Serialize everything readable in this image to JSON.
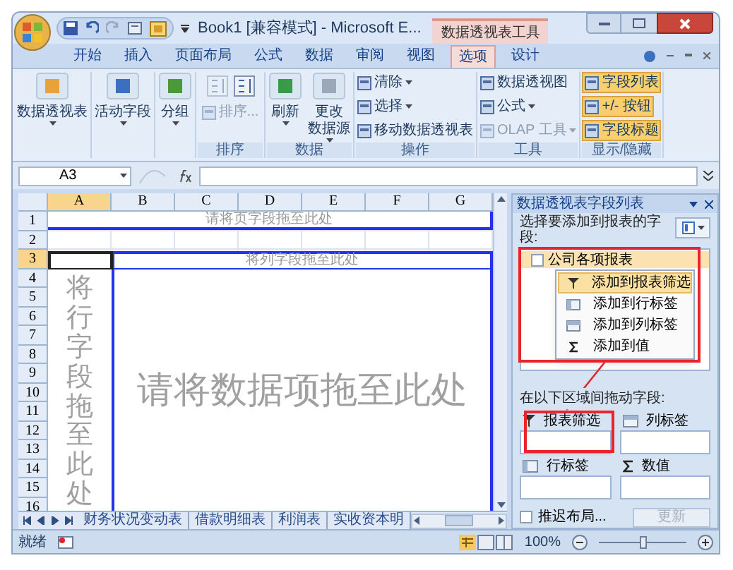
{
  "title_bar": {
    "title": "Book1  [兼容模式] - Microsoft E...",
    "context_tab": "数据透视表工具"
  },
  "ribbon_tabs": [
    {
      "label": "开始",
      "selected": false
    },
    {
      "label": "插入",
      "selected": false
    },
    {
      "label": "页面布局",
      "selected": false
    },
    {
      "label": "公式",
      "selected": false
    },
    {
      "label": "数据",
      "selected": false
    },
    {
      "label": "审阅",
      "selected": false
    },
    {
      "label": "视图",
      "selected": false
    },
    {
      "label": "选项",
      "selected": true
    },
    {
      "label": "设计",
      "selected": false
    }
  ],
  "ribbon_groups": [
    {
      "buttons": [
        {
          "kind": "large",
          "label": "数据透视表",
          "dropdown": true,
          "disabled": false
        }
      ]
    },
    {
      "buttons": [
        {
          "kind": "large",
          "label": "活动字段",
          "dropdown": true,
          "disabled": false
        }
      ]
    },
    {
      "buttons": [
        {
          "kind": "large",
          "label": "分组",
          "dropdown": true,
          "disabled": false
        }
      ]
    },
    {
      "label": "排序",
      "buttons": [
        {
          "kind": "icon",
          "disabled": true
        },
        {
          "kind": "icon",
          "disabled": false
        },
        {
          "kind": "small",
          "label": "排序...",
          "dropdown": false,
          "disabled": true
        }
      ]
    },
    {
      "label": "数据",
      "buttons": [
        {
          "kind": "large",
          "label": "刷新",
          "dropdown": true,
          "disabled": false
        },
        {
          "kind": "large",
          "label": "更改",
          "label_2": "数据源",
          "dropdown": true,
          "disabled": false
        }
      ]
    },
    {
      "label": "操作",
      "buttons": [
        {
          "kind": "small",
          "label": "清除",
          "dropdown": true,
          "disabled": false
        },
        {
          "kind": "small",
          "label": "选择",
          "dropdown": true,
          "disabled": false
        },
        {
          "kind": "small",
          "label": "移动数据透视表",
          "dropdown": false,
          "disabled": false
        }
      ]
    },
    {
      "label": "工具",
      "buttons": [
        {
          "kind": "small",
          "label": "数据透视图",
          "dropdown": false,
          "disabled": false
        },
        {
          "kind": "small",
          "label": "公式",
          "dropdown": true,
          "disabled": false
        },
        {
          "kind": "small",
          "label": "OLAP 工具",
          "dropdown": true,
          "disabled": true
        }
      ]
    },
    {
      "label": "显示/隐藏",
      "buttons": [
        {
          "kind": "small",
          "label": "字段列表",
          "dropdown": false,
          "disabled": false,
          "on": true
        },
        {
          "kind": "small",
          "label": "+/- 按钮",
          "dropdown": false,
          "disabled": false,
          "on": true
        },
        {
          "kind": "small",
          "label": "字段标题",
          "dropdown": false,
          "disabled": false,
          "on": true
        }
      ]
    }
  ],
  "formula_bar": {
    "name_box": "A3"
  },
  "sheet": {
    "columns": [
      {
        "label": "A",
        "selected": true
      },
      {
        "label": "B",
        "selected": false
      },
      {
        "label": "C",
        "selected": false
      },
      {
        "label": "D",
        "selected": false
      },
      {
        "label": "E",
        "selected": false
      },
      {
        "label": "F",
        "selected": false
      },
      {
        "label": "G",
        "selected": false
      }
    ],
    "rows": [
      {
        "label": "1",
        "selected": false
      },
      {
        "label": "2",
        "selected": false
      },
      {
        "label": "3",
        "selected": true
      },
      {
        "label": "4",
        "selected": false
      },
      {
        "label": "5",
        "selected": false
      },
      {
        "label": "6",
        "selected": false
      },
      {
        "label": "7",
        "selected": false
      },
      {
        "label": "8",
        "selected": false
      },
      {
        "label": "9",
        "selected": false
      },
      {
        "label": "10",
        "selected": false
      },
      {
        "label": "11",
        "selected": false
      },
      {
        "label": "12",
        "selected": false
      },
      {
        "label": "13",
        "selected": false
      },
      {
        "label": "14",
        "selected": false
      },
      {
        "label": "15",
        "selected": false
      },
      {
        "label": "16",
        "selected": false
      }
    ],
    "pivot": {
      "page_drop": "请将页字段拖至此处",
      "column_drop": "将列字段拖至此处",
      "row_drop": "将行字段拖至此处",
      "data_drop": "请将数据项拖至此处"
    }
  },
  "sheet_tabs": [
    {
      "label": "财务状况变动表",
      "selected": false
    },
    {
      "label": "借款明细表",
      "selected": false
    },
    {
      "label": "利润表",
      "selected": false
    },
    {
      "label": "实收资本明",
      "selected": false
    }
  ],
  "field_list": {
    "title": "数据透视表字段列表",
    "prompt": "选择要添加到报表的字段:",
    "fields": [
      {
        "label": "公司各项报表",
        "checked": false,
        "selected": true
      }
    ],
    "context_menu": [
      {
        "kind": "filter",
        "label": "添加到报表筛选",
        "selected": true
      },
      {
        "kind": "rows",
        "label": "添加到行标签",
        "selected": false
      },
      {
        "kind": "columns",
        "label": "添加到列标签",
        "selected": false
      },
      {
        "kind": "values",
        "label": "添加到值",
        "selected": false
      }
    ],
    "areas_prompt": "在以下区域间拖动字段:",
    "areas": [
      {
        "kind": "filter",
        "label": "报表筛选"
      },
      {
        "kind": "columns",
        "label": "列标签"
      },
      {
        "kind": "rows",
        "label": "行标签"
      },
      {
        "kind": "values",
        "label": "数值"
      }
    ],
    "defer": {
      "label": "推迟布局...",
      "checked": false
    },
    "update_button": {
      "label": "更新",
      "disabled": true
    }
  },
  "status_bar": {
    "status": "就绪",
    "zoom": "100%",
    "level": 0.5
  }
}
